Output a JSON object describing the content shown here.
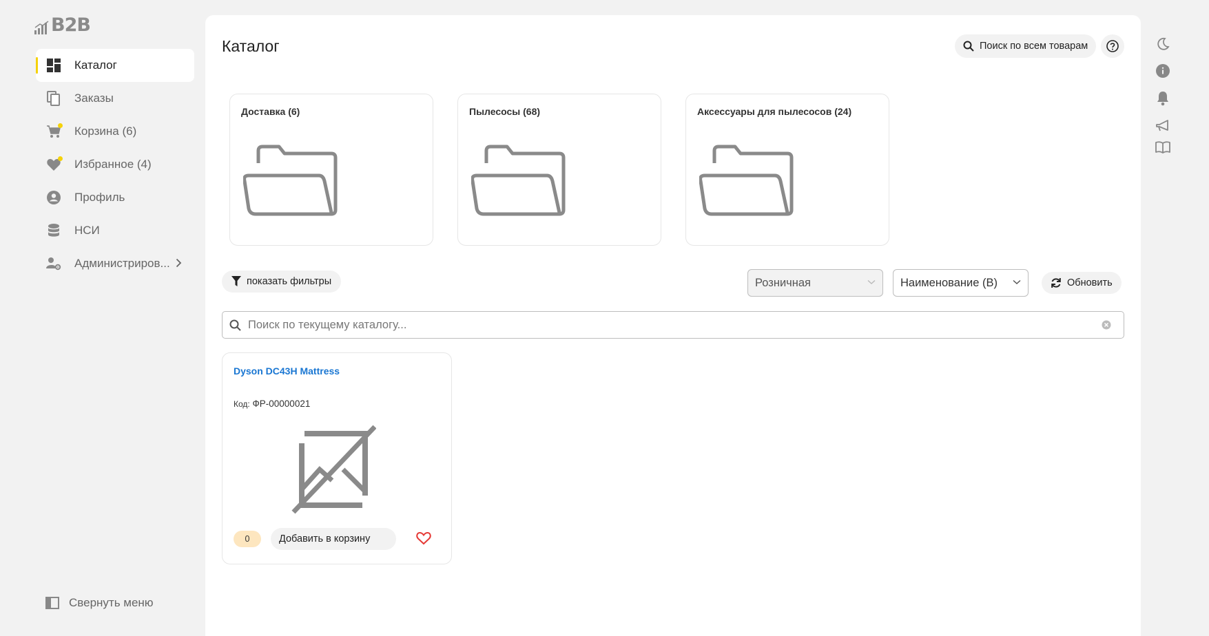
{
  "logo": {
    "text": "B2B"
  },
  "sidebar": {
    "items": [
      {
        "label": "Каталог",
        "icon": "dashboard-icon"
      },
      {
        "label": "Заказы",
        "icon": "copy-icon"
      },
      {
        "label": "Корзина (6)",
        "icon": "cart-icon"
      },
      {
        "label": "Избранное (4)",
        "icon": "heart-icon"
      },
      {
        "label": "Профиль",
        "icon": "account-icon"
      },
      {
        "label": "НСИ",
        "icon": "database-icon"
      },
      {
        "label": "Администриров...",
        "icon": "admin-icon"
      }
    ],
    "collapse_label": "Свернуть меню"
  },
  "header": {
    "title": "Каталог",
    "global_search_label": "Поиск по всем товарам"
  },
  "categories": [
    {
      "title": "Доставка (6)"
    },
    {
      "title": "Пылесосы (68)"
    },
    {
      "title": "Аксессуары для пылесосов (24)"
    }
  ],
  "toolbar": {
    "filters_label": "показать фильтры",
    "price_type": "Розничная",
    "sort": "Наименование (В)",
    "refresh_label": "Обновить"
  },
  "catalog_search": {
    "placeholder": "Поиск по текущему каталогу..."
  },
  "products": [
    {
      "name": "Dyson DC43H Mattress",
      "code_label": "Код:",
      "code": "ФР-00000021",
      "qty": "0",
      "add_label": "Добавить в корзину"
    }
  ],
  "colors": {
    "accent": "#f5d20a",
    "link": "#1976d2",
    "favorite": "#e53935",
    "qty_badge": "#fde6bf"
  }
}
